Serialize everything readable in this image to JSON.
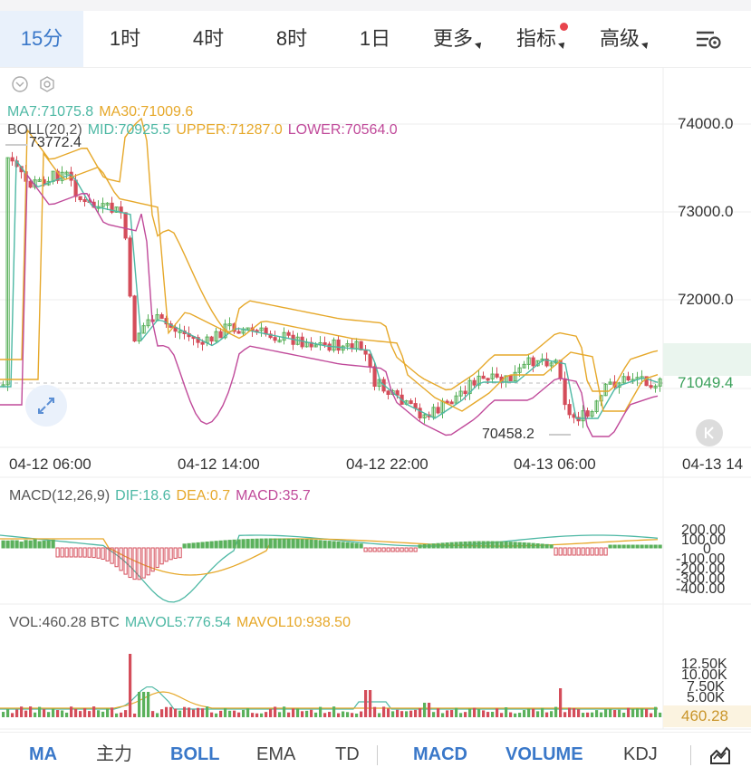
{
  "tabs": [
    {
      "label": "15分",
      "active": true
    },
    {
      "label": "1时"
    },
    {
      "label": "4时"
    },
    {
      "label": "8时"
    },
    {
      "label": "1日"
    },
    {
      "label": "更多"
    },
    {
      "label": "指标"
    },
    {
      "label": "高级"
    }
  ],
  "main_legend": {
    "ma7": "MA7:71075.8",
    "ma30": "MA30:71009.6",
    "boll": "BOLL(20,2)",
    "mid": "MID:70925.5",
    "upper": "UPPER:71287.0",
    "lower": "LOWER:70564.0"
  },
  "price_axis": [
    "74000.0",
    "73000.0",
    "72000.0"
  ],
  "current_price": "71049.4",
  "high_label": "73772.4",
  "low_label": "70458.2",
  "time_axis": [
    "04-12 06:00",
    "04-12 14:00",
    "04-12 22:00",
    "04-13 06:00",
    "04-13 14"
  ],
  "macd_legend": {
    "params": "MACD(12,26,9)",
    "dif": "DIF:18.6",
    "dea": "DEA:0.7",
    "macd": "MACD:35.7"
  },
  "macd_axis": [
    "200.00",
    "100.00",
    "0",
    "-100.00",
    "-200.00",
    "-300.00",
    "-400.00"
  ],
  "vol_legend": {
    "vol": "VOL:460.28 BTC",
    "mavol5": "MAVOL5:776.54",
    "mavol10": "MAVOL10:938.50"
  },
  "vol_axis": [
    "12.50K",
    "10.00K",
    "7.50K",
    "5.00K"
  ],
  "vol_current": "460.28",
  "bottom_tabs": [
    {
      "label": "MA",
      "active": true
    },
    {
      "label": "主力"
    },
    {
      "label": "BOLL",
      "active": true
    },
    {
      "label": "EMA"
    },
    {
      "label": "TD"
    },
    {
      "label": "MACD",
      "active": true
    },
    {
      "label": "VOLUME",
      "active": true
    },
    {
      "label": "KDJ"
    }
  ],
  "colors": {
    "up": "#5bb15c",
    "down": "#d44d5a",
    "ma7": "#4db8a4",
    "ma30": "#e6a82a",
    "mid": "#4db8a4",
    "upper": "#e6a82a",
    "lower": "#c04a9a",
    "accent": "#3a78c9"
  },
  "icons": [
    "chevron-down-icon",
    "settings-hex-icon",
    "chart-settings-icon",
    "expand-icon",
    "rewind-icon",
    "draw-tool-icon"
  ]
}
